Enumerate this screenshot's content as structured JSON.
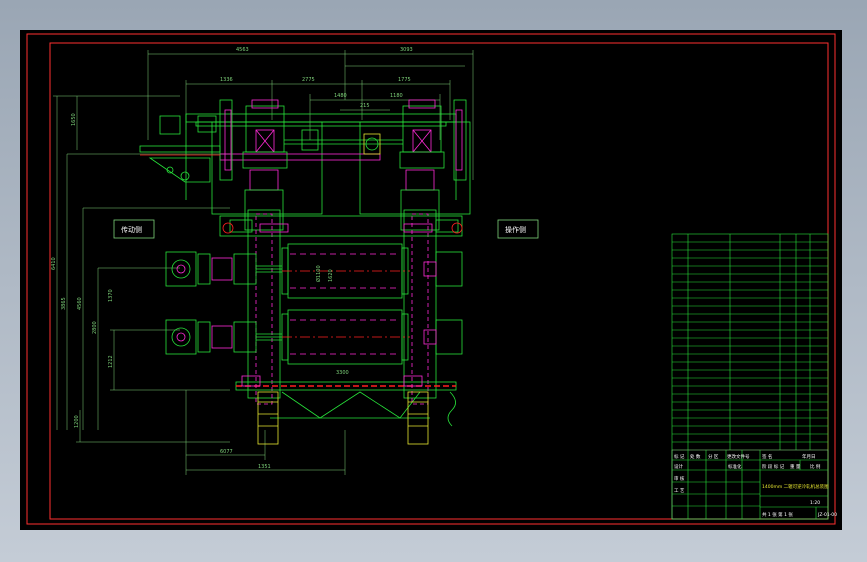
{
  "colors": {
    "background": "#000000",
    "outer_frame": "#ff3030",
    "geometry": "#27e33a",
    "dims": "#7ed37a",
    "highlight": "#ff2bd6",
    "centerline": "#ff2020",
    "white": "#ffffff",
    "yellow": "#e6e630"
  },
  "labels": {
    "drive_side": "传动侧",
    "operator_side": "操作侧"
  },
  "dims_top": {
    "d1": "4563",
    "d2": "3093",
    "d3": "1336",
    "d4": "2775",
    "d5": "1775",
    "d6": "1480",
    "d7": "1180",
    "d8": "215"
  },
  "dims_left": {
    "h1": "6410",
    "h2": "1650",
    "h3": "3865",
    "h4": "4560",
    "h5": "1370",
    "h6": "2800",
    "h7": "1212",
    "h8": "1200"
  },
  "dims_bottom": {
    "b1": "3300",
    "b2": "6077",
    "b3": "1351"
  },
  "dims_roll": {
    "r1": "Ø1100",
    "r2": "1620"
  },
  "title_block": {
    "row1": [
      "标 记",
      "处 数",
      "分 区",
      "更改文件号",
      "签 名",
      "年月日"
    ],
    "row2": [
      "设计",
      "",
      "标准化",
      "",
      "阶 段 标 记",
      "重 量",
      "比 例"
    ],
    "title": "1400mm 二辊可逆冷轧机总装图",
    "designer": "审 核",
    "approver": "工 艺",
    "ratio": "1:20",
    "sheet": "共 1 张 第 1 张",
    "drawing_no": "JZ-01-00"
  }
}
